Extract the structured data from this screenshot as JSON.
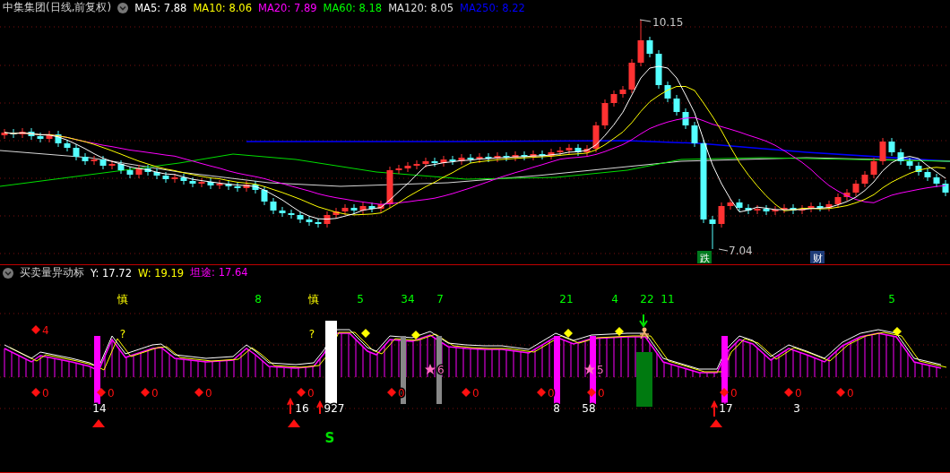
{
  "price_panel": {
    "title": "中集集团(日线,前复权)",
    "indicators": [
      {
        "label": "MA5: 7.88",
        "color": "#ffffff"
      },
      {
        "label": "MA10: 8.06",
        "color": "#ffff00"
      },
      {
        "label": "MA20: 7.89",
        "color": "#ff00ff"
      },
      {
        "label": "MA60: 8.18",
        "color": "#00ff00"
      },
      {
        "label": "MA120: 8.05",
        "color": "#e0e0e0"
      },
      {
        "label": "MA250: 8.22",
        "color": "#0000ff"
      }
    ],
    "high_label": "10.15",
    "low_label": "7.04",
    "markers": [
      {
        "text": "跌",
        "color": "#007a1e"
      },
      {
        "text": "财",
        "color": "#1e3c78"
      }
    ]
  },
  "indicator_panel": {
    "title": "买卖量异动标",
    "readings": [
      {
        "label": "Y: 17.72",
        "color": "#ffffff"
      },
      {
        "label": "W: 19.19",
        "color": "#ffff00"
      },
      {
        "label": "坦途: 17.64",
        "color": "#ff00ff"
      }
    ],
    "top_labels": [
      {
        "text": "慎",
        "kind": "warning"
      },
      {
        "text": "8",
        "kind": "count"
      },
      {
        "text": "慎",
        "kind": "warning"
      },
      {
        "text": "5",
        "kind": "count"
      },
      {
        "text": "34",
        "kind": "count"
      },
      {
        "text": "7",
        "kind": "count"
      },
      {
        "text": "21",
        "kind": "count"
      },
      {
        "text": "4",
        "kind": "count"
      },
      {
        "text": "22",
        "kind": "count"
      },
      {
        "text": "11",
        "kind": "count"
      },
      {
        "text": "5",
        "kind": "count"
      }
    ],
    "question_marks": [
      "?",
      "?"
    ],
    "diamond_labels": [
      "4",
      "0",
      "0",
      "0",
      "0",
      "0",
      "0",
      "0",
      "0",
      "0",
      "0",
      "0",
      "0"
    ],
    "star_labels": [
      "6",
      "5"
    ],
    "bottom_numbers": [
      "14",
      "16",
      "927",
      "8",
      "58",
      "17",
      "3"
    ],
    "signal": "S"
  }
}
